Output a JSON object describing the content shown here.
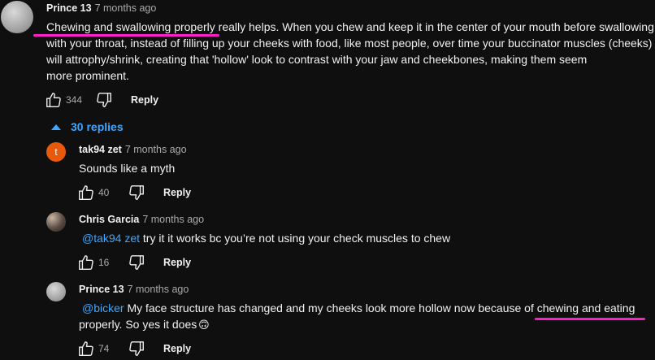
{
  "top_comment": {
    "author": "Prince 13",
    "time": "7 months ago",
    "line1": "Chewing and swallowing properly really helps. When you chew and keep it in the center of your mouth before swallowing",
    "line2": "with your throat, instead of filling up your cheeks with food, like most people, over time your buccinator muscles (cheeks)",
    "line3": "will attrophy/shrink, creating that 'hollow' look to contrast with your jaw and cheekbones, making them seem",
    "line4": "more prominent.",
    "likes": "344",
    "reply_label": "Reply"
  },
  "replies_toggle": {
    "label": "30 replies"
  },
  "replies": [
    {
      "author": "tak94 zet",
      "time": "7 months ago",
      "avatar_letter": "t",
      "avatar_color": "#e8590c",
      "mention": "",
      "text": "Sounds like a myth",
      "likes": "40",
      "reply_label": "Reply"
    },
    {
      "author": "Chris Garcia",
      "time": "7 months ago",
      "mention": "@tak94 zet",
      "text": " try it it works bc you’re not using your check muscles to chew",
      "likes": "16",
      "reply_label": "Reply"
    },
    {
      "author": "Prince 13",
      "time": "7 months ago",
      "mention": "@bicker",
      "text": " My face structure has changed and my cheeks look more hollow now because of chewing and eating",
      "text2": "properly. So yes it does",
      "emoji": "🙃",
      "likes": "74",
      "reply_label": "Reply"
    }
  ],
  "colors": {
    "background": "#0f0f0f",
    "link": "#3ea6ff",
    "highlight": "#ff1fc8"
  }
}
